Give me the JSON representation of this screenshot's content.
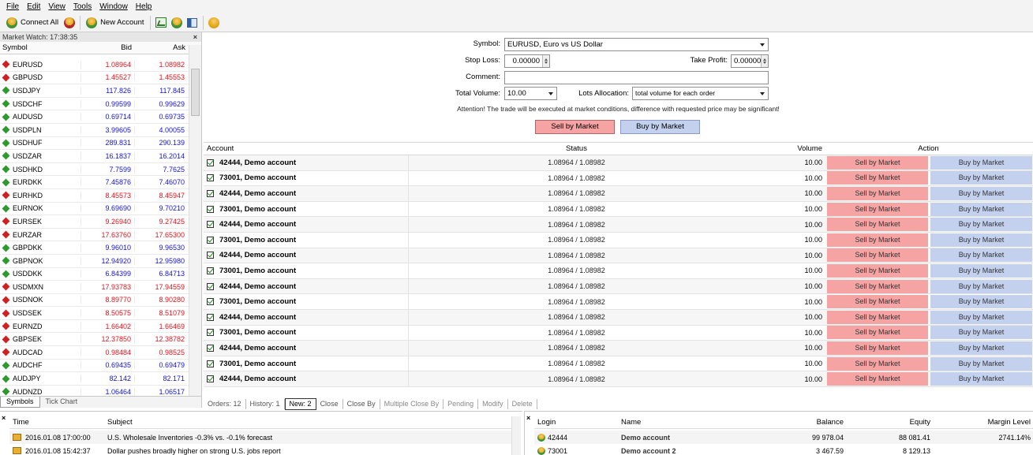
{
  "menu": [
    "File",
    "Edit",
    "View",
    "Tools",
    "Window",
    "Help"
  ],
  "toolbar": {
    "connect_all": "Connect All",
    "new_account": "New Account"
  },
  "market_watch": {
    "title": "Market Watch: 17:38:35",
    "close": "×",
    "headers": {
      "symbol": "Symbol",
      "bid": "Bid",
      "ask": "Ask"
    },
    "rows": [
      {
        "symbol": "EURUSD",
        "bid": "1.08964",
        "ask": "1.08982",
        "dir": "down"
      },
      {
        "symbol": "GBPUSD",
        "bid": "1.45527",
        "ask": "1.45553",
        "dir": "down"
      },
      {
        "symbol": "USDJPY",
        "bid": "117.826",
        "ask": "117.845",
        "dir": "up"
      },
      {
        "symbol": "USDCHF",
        "bid": "0.99599",
        "ask": "0.99629",
        "dir": "up"
      },
      {
        "symbol": "AUDUSD",
        "bid": "0.69714",
        "ask": "0.69735",
        "dir": "up"
      },
      {
        "symbol": "USDPLN",
        "bid": "3.99605",
        "ask": "4.00055",
        "dir": "up"
      },
      {
        "symbol": "USDHUF",
        "bid": "289.831",
        "ask": "290.139",
        "dir": "up"
      },
      {
        "symbol": "USDZAR",
        "bid": "16.1837",
        "ask": "16.2014",
        "dir": "up"
      },
      {
        "symbol": "USDHKD",
        "bid": "7.7599",
        "ask": "7.7625",
        "dir": "up"
      },
      {
        "symbol": "EURDKK",
        "bid": "7.45876",
        "ask": "7.46070",
        "dir": "up"
      },
      {
        "symbol": "EURHKD",
        "bid": "8.45573",
        "ask": "8.45947",
        "dir": "down"
      },
      {
        "symbol": "EURNOK",
        "bid": "9.69690",
        "ask": "9.70210",
        "dir": "up"
      },
      {
        "symbol": "EURSEK",
        "bid": "9.26940",
        "ask": "9.27425",
        "dir": "down"
      },
      {
        "symbol": "EURZAR",
        "bid": "17.63760",
        "ask": "17.65300",
        "dir": "down"
      },
      {
        "symbol": "GBPDKK",
        "bid": "9.96010",
        "ask": "9.96530",
        "dir": "up"
      },
      {
        "symbol": "GBPNOK",
        "bid": "12.94920",
        "ask": "12.95980",
        "dir": "up"
      },
      {
        "symbol": "USDDKK",
        "bid": "6.84399",
        "ask": "6.84713",
        "dir": "up"
      },
      {
        "symbol": "USDMXN",
        "bid": "17.93783",
        "ask": "17.94559",
        "dir": "down"
      },
      {
        "symbol": "USDNOK",
        "bid": "8.89770",
        "ask": "8.90280",
        "dir": "down"
      },
      {
        "symbol": "USDSEK",
        "bid": "8.50575",
        "ask": "8.51079",
        "dir": "down"
      },
      {
        "symbol": "EURNZD",
        "bid": "1.66402",
        "ask": "1.66469",
        "dir": "down"
      },
      {
        "symbol": "GBPSEK",
        "bid": "12.37850",
        "ask": "12.38782",
        "dir": "down"
      },
      {
        "symbol": "AUDCAD",
        "bid": "0.98484",
        "ask": "0.98525",
        "dir": "down"
      },
      {
        "symbol": "AUDCHF",
        "bid": "0.69435",
        "ask": "0.69479",
        "dir": "up"
      },
      {
        "symbol": "AUDJPY",
        "bid": "82.142",
        "ask": "82.171",
        "dir": "up"
      },
      {
        "symbol": "AUDNZD",
        "bid": "1.06464",
        "ask": "1.06517",
        "dir": "up"
      }
    ],
    "tabs": [
      "Symbols",
      "Tick Chart"
    ]
  },
  "order_form": {
    "symbol_label": "Symbol:",
    "symbol_value": "EURUSD,  Euro vs US Dollar",
    "stop_loss_label": "Stop Loss:",
    "stop_loss_value": "0.00000",
    "take_profit_label": "Take Profit:",
    "take_profit_value": "0.00000",
    "comment_label": "Comment:",
    "comment_value": "",
    "total_volume_label": "Total Volume:",
    "total_volume_value": "10.00",
    "lots_label": "Lots Allocation:",
    "lots_value": "total volume for each order",
    "attention": "Attention! The trade will be executed at market conditions, difference with requested price may be significant!",
    "sell_button": "Sell by Market",
    "buy_button": "Buy by Market"
  },
  "grid": {
    "headers": {
      "account": "Account",
      "status": "Status",
      "volume": "Volume",
      "action": "Action"
    },
    "sell_label": "Sell by Market",
    "buy_label": "Buy by Market",
    "rows": [
      {
        "account": "42444,  Demo account",
        "status": "1.08964 / 1.08982",
        "volume": "10.00"
      },
      {
        "account": "73001,  Demo account",
        "status": "1.08964 / 1.08982",
        "volume": "10.00"
      },
      {
        "account": "42444,  Demo account",
        "status": "1.08964 / 1.08982",
        "volume": "10.00"
      },
      {
        "account": "73001,  Demo account",
        "status": "1.08964 / 1.08982",
        "volume": "10.00"
      },
      {
        "account": "42444,  Demo account",
        "status": "1.08964 / 1.08982",
        "volume": "10.00"
      },
      {
        "account": "73001,  Demo account",
        "status": "1.08964 / 1.08982",
        "volume": "10.00"
      },
      {
        "account": "42444,  Demo account",
        "status": "1.08964 / 1.08982",
        "volume": "10.00"
      },
      {
        "account": "73001,  Demo account",
        "status": "1.08964 / 1.08982",
        "volume": "10.00"
      },
      {
        "account": "42444,  Demo account",
        "status": "1.08964 / 1.08982",
        "volume": "10.00"
      },
      {
        "account": "73001,  Demo account",
        "status": "1.08964 / 1.08982",
        "volume": "10.00"
      },
      {
        "account": "42444,  Demo account",
        "status": "1.08964 / 1.08982",
        "volume": "10.00"
      },
      {
        "account": "73001,  Demo account",
        "status": "1.08964 / 1.08982",
        "volume": "10.00"
      },
      {
        "account": "42444,  Demo account",
        "status": "1.08964 / 1.08982",
        "volume": "10.00"
      },
      {
        "account": "73001,  Demo account",
        "status": "1.08964 / 1.08982",
        "volume": "10.00"
      },
      {
        "account": "42444,  Demo account",
        "status": "1.08964 / 1.08982",
        "volume": "10.00"
      }
    ]
  },
  "bottom_tabs": [
    {
      "label": "Orders: 12",
      "state": "normal"
    },
    {
      "label": "History: 1",
      "state": "normal"
    },
    {
      "label": "New: 2",
      "state": "active"
    },
    {
      "label": "Close",
      "state": "normal"
    },
    {
      "label": "Close By",
      "state": "normal"
    },
    {
      "label": "Multiple Close By",
      "state": "disabled"
    },
    {
      "label": "Pending",
      "state": "disabled"
    },
    {
      "label": "Modify",
      "state": "disabled"
    },
    {
      "label": "Delete",
      "state": "disabled"
    }
  ],
  "news": {
    "headers": {
      "time": "Time",
      "subject": "Subject"
    },
    "rows": [
      {
        "time": "2016.01.08 17:00:00",
        "subject": "U.S. Wholesale Inventories -0.3% vs. -0.1% forecast"
      },
      {
        "time": "2016.01.08 15:42:37",
        "subject": "Dollar pushes broadly higher on strong U.S. jobs report"
      }
    ]
  },
  "accounts": {
    "headers": {
      "login": "Login",
      "name": "Name",
      "balance": "Balance",
      "equity": "Equity",
      "margin_level": "Margin Level"
    },
    "rows": [
      {
        "login": "42444",
        "name": "Demo account",
        "balance": "99 978.04",
        "equity": "88 081.41",
        "margin_level": "2741.14%"
      },
      {
        "login": "73001",
        "name": "Demo account 2",
        "balance": "3 467.59",
        "equity": "8 129.13",
        "margin_level": ""
      }
    ]
  },
  "colors": {
    "sell": "#f5a3a3",
    "buy": "#c3d1ef",
    "bid_ask_up": "#1515d8",
    "bid_ask_down": "#e0161e"
  }
}
